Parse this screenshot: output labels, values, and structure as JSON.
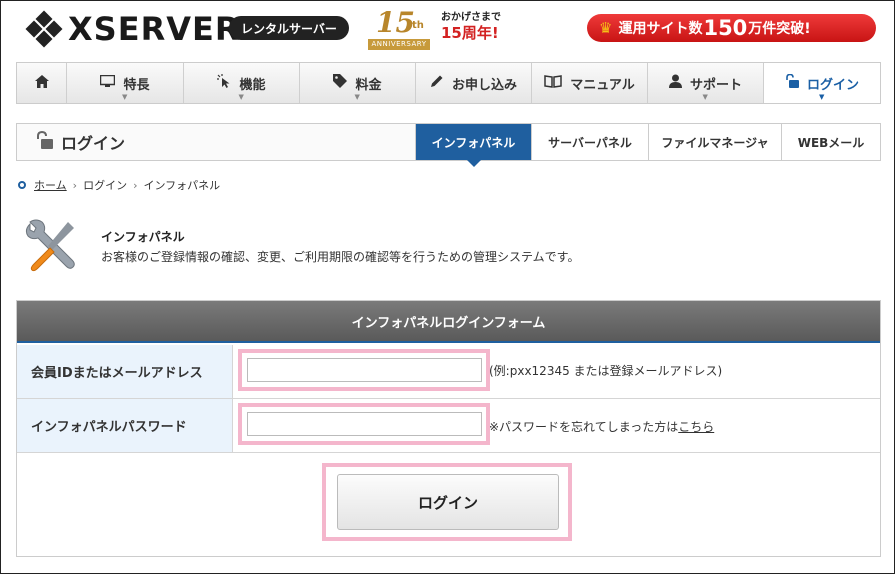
{
  "header": {
    "logo_text": "XSERVER",
    "rental_badge": "レンタルサーバー",
    "anniversary": {
      "number": "15",
      "suffix": "th",
      "ribbon": "ANNIVERSARY"
    },
    "thanks_small": "おかげさまで",
    "thanks_big": "15周年!",
    "promo": {
      "prefix": "運用サイト数",
      "number": "150",
      "suffix": "万件突破!"
    }
  },
  "nav": {
    "items": [
      {
        "label": "",
        "icon": "home-icon"
      },
      {
        "label": "特長",
        "icon": "monitor-icon"
      },
      {
        "label": "機能",
        "icon": "click-icon"
      },
      {
        "label": "料金",
        "icon": "tag-icon"
      },
      {
        "label": "お申し込み",
        "icon": "pencil-icon"
      },
      {
        "label": "マニュアル",
        "icon": "book-icon"
      },
      {
        "label": "サポート",
        "icon": "user-icon"
      },
      {
        "label": "ログイン",
        "icon": "unlock-icon"
      }
    ]
  },
  "subnav": {
    "title": "ログイン",
    "tabs": [
      {
        "label": "インフォパネル"
      },
      {
        "label": "サーバーパネル"
      },
      {
        "label": "ファイルマネージャ"
      },
      {
        "label": "WEBメール"
      }
    ]
  },
  "breadcrumb": {
    "home": "ホーム",
    "login": "ログイン",
    "current": "インフォパネル"
  },
  "intro": {
    "title": "インフォパネル",
    "description": "お客様のご登録情報の確認、変更、ご利用期限の確認等を行うための管理システムです。"
  },
  "form": {
    "heading": "インフォパネルログインフォーム",
    "id_label": "会員IDまたはメールアドレス",
    "id_value": "",
    "id_note": "(例:pxx12345 または登録メールアドレス)",
    "password_label": "インフォパネルパスワード",
    "password_value": "",
    "password_note": "※パスワードを忘れてしまった方は",
    "password_link": "こちら",
    "submit_label": "ログイン"
  },
  "colors": {
    "accent": "#1f5f9f",
    "promo": "#d32222",
    "highlight": "#f4b6cc",
    "label_bg": "#eaf3fc"
  }
}
